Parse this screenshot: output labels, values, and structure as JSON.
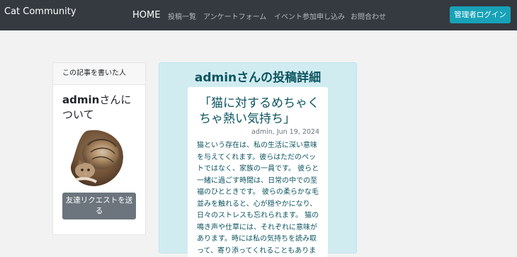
{
  "navbar": {
    "brand": "Cat Community",
    "home": "HOME",
    "links": [
      "投稿一覧",
      "アンケートフォーム",
      "イベント参加申し込み",
      "お問合わせ"
    ],
    "admin_login": "管理者ログイン"
  },
  "author": {
    "header": "この記事を書いた人",
    "name": "admin",
    "about_suffix": "さんについて",
    "friend_request": "友達リクエストを送る"
  },
  "post": {
    "heading": "adminさんの投稿詳細",
    "title": "「猫に対するめちゃくちゃ熱い気持ち」",
    "meta": "admin, Jun 19, 2024",
    "body": "猫という存在は、私の生活に深い意味を与えてくれます。彼らはただのペットではなく、家族の一員です。 彼らと一緒に過ごす時間は、日常の中での至福のひとときです。 彼らの柔らかな毛並みを触れると、心が穏やかになり、日々のストレスも忘れられます。 猫の鳴き声や仕草には、それぞれに意味があります。時には私の気持ちを読み取って、寄り添ってくれることもあります。"
  },
  "colors": {
    "navbar_bg": "#343a40",
    "accent": "#17a2b8",
    "info_bg": "#d1ecf1",
    "info_text": "#0c5460",
    "secondary_btn": "#6c757d"
  }
}
